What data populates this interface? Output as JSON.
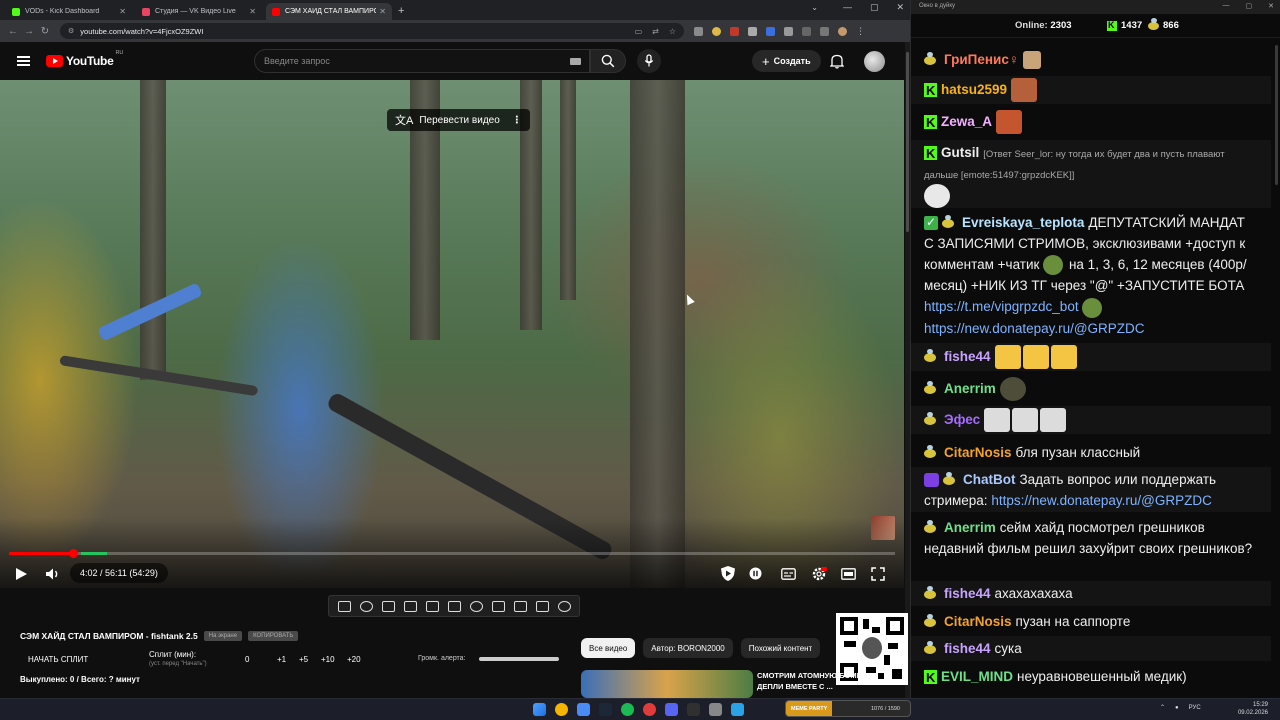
{
  "browser": {
    "tabs": [
      {
        "title": "VODs - Kick Dashboard",
        "favicon_color": "#53fc18",
        "active": false
      },
      {
        "title": "Студия — VK Видео Live",
        "favicon_color": "#e94560",
        "active": false
      },
      {
        "title": "СЭМ ХАЙД СТАЛ ВАМПИРОМ",
        "favicon_color": "#ff0000",
        "active": true
      }
    ],
    "url": "youtube.com/watch?v=4FjcxOZ9ZWI"
  },
  "youtube": {
    "logo_text": "YouTube",
    "logo_region": "RU",
    "search_placeholder": "Введите запрос",
    "create_label": "Создать",
    "translate_label": "Перевести видео",
    "time_display": "4:02 / 56:11 (54:29)",
    "progress_fraction": 0.072,
    "buffer_fraction": 0.03,
    "title": "СЭМ ХАЙД СТАЛ ВАМПИРОМ - fishtank 2.5",
    "chip1": "На экране",
    "chip2": "КОПИРОВАТЬ",
    "split_start": "НАЧАТЬ СПЛИТ",
    "split_label": "Сплит (мин):",
    "split_hint": "(уст. перед \"Начать\")",
    "split_value": "0",
    "split_buttons": [
      "+1",
      "+5",
      "+10",
      "+20"
    ],
    "alert_volume_label": "Громк. алерта:",
    "bought_status": "Выкуплено: 0 / Всего: ? минут",
    "filters": [
      "Все видео",
      "Автор: BORON2000",
      "Похожий контент"
    ],
    "rec_title": "СМОТРИМ АТОМНУЮ БОМБУ ДЕПЛИ ВМЕСТЕ С ..."
  },
  "chat": {
    "window_title": "Окно в дуйку",
    "online_label": "Online:",
    "online_count": "2303",
    "kick_count": "1437",
    "bee_count": "866",
    "messages": [
      {
        "name": "ГриПенис♀",
        "color": "#ff7a59",
        "badge": "bee",
        "text": "",
        "emotes": [
          "#c9a47a"
        ]
      },
      {
        "name": "hatsu2599",
        "color": "#f7b21c",
        "badge": "k",
        "text": "",
        "emotes": [
          "#b5603a"
        ]
      },
      {
        "name": "Zewa_A",
        "color": "#f3b0ff",
        "badge": "k",
        "text": "",
        "emotes": [
          "#c4552f"
        ]
      },
      {
        "name": "Gutsil",
        "color": "#f0f0f0",
        "badge": "k",
        "reply": "[Ответ Seer_lor: ну тогда их будет два и пусть плавают дальше [emote:51497:grpzdcKEK]]",
        "text": "",
        "emotes": [
          "#e8e8e8"
        ]
      },
      {
        "name": "Evreiskaya_teplota",
        "color": "#b7e4ff",
        "badge": "check+bee",
        "text": "ДЕПУТАТСКИЙ МАНДАТ С ЗАПИСЯМИ СТРИМОВ, эксклюзивами +доступ к комментам +чатик",
        "text2": "на 1, 3, 6, 12 месяцев (400р/месяц) +НИК ИЗ ТГ через \"@\" +ЗАПУСТИТЕ БОТА",
        "link1": "https://t.me/vipgrpzdc_bot",
        "link2": "https://new.donatepay.ru/@GRPZDC"
      },
      {
        "name": "fishe44",
        "color": "#c9a4ff",
        "badge": "bee",
        "text": "",
        "emotes": [
          "#f4c542",
          "#f4c542",
          "#f4c542"
        ]
      },
      {
        "name": "Anerrim",
        "color": "#6fe08a",
        "badge": "bee",
        "text": "",
        "emotes": [
          "#4d4d3a"
        ]
      },
      {
        "name": "Эфес",
        "color": "#a66bff",
        "badge": "bee",
        "text": "",
        "emotes": [
          "#dcdcdc",
          "#dcdcdc",
          "#dcdcdc"
        ]
      },
      {
        "name": "CitarNosis",
        "color": "#f2a32c",
        "badge": "bee",
        "text": "бля пузан классный"
      },
      {
        "name": "ChatBot",
        "color": "#a9c9ff",
        "badge": "bot+bee",
        "text": "Задать вопрос или поддержать стримера:",
        "link1": "https://new.donatepay.ru/@GRPZDC"
      },
      {
        "name": "Anerrim",
        "color": "#6fe08a",
        "badge": "bee",
        "text": "сейм хайд посмотрел грешников недавний фильм решил захуйрит своих грешников?"
      },
      {
        "name": "fishe44",
        "color": "#c9a4ff",
        "badge": "bee",
        "text": "ахахахахаха"
      },
      {
        "name": "CitarNosis",
        "color": "#f2a32c",
        "badge": "bee",
        "text": "пузан на саппорте"
      },
      {
        "name": "fishe44",
        "color": "#c9a4ff",
        "badge": "bee",
        "text": "сука"
      },
      {
        "name": "EVIL_MIND",
        "color": "#6fe08a",
        "badge": "k",
        "text": "неуравновешенный медик)"
      }
    ]
  },
  "taskbar": {
    "meme_label": "MEME PARTY",
    "meme_count": "1076 / 1590",
    "lang": "РУС",
    "time": "15:29",
    "date": "09.02.2026"
  }
}
